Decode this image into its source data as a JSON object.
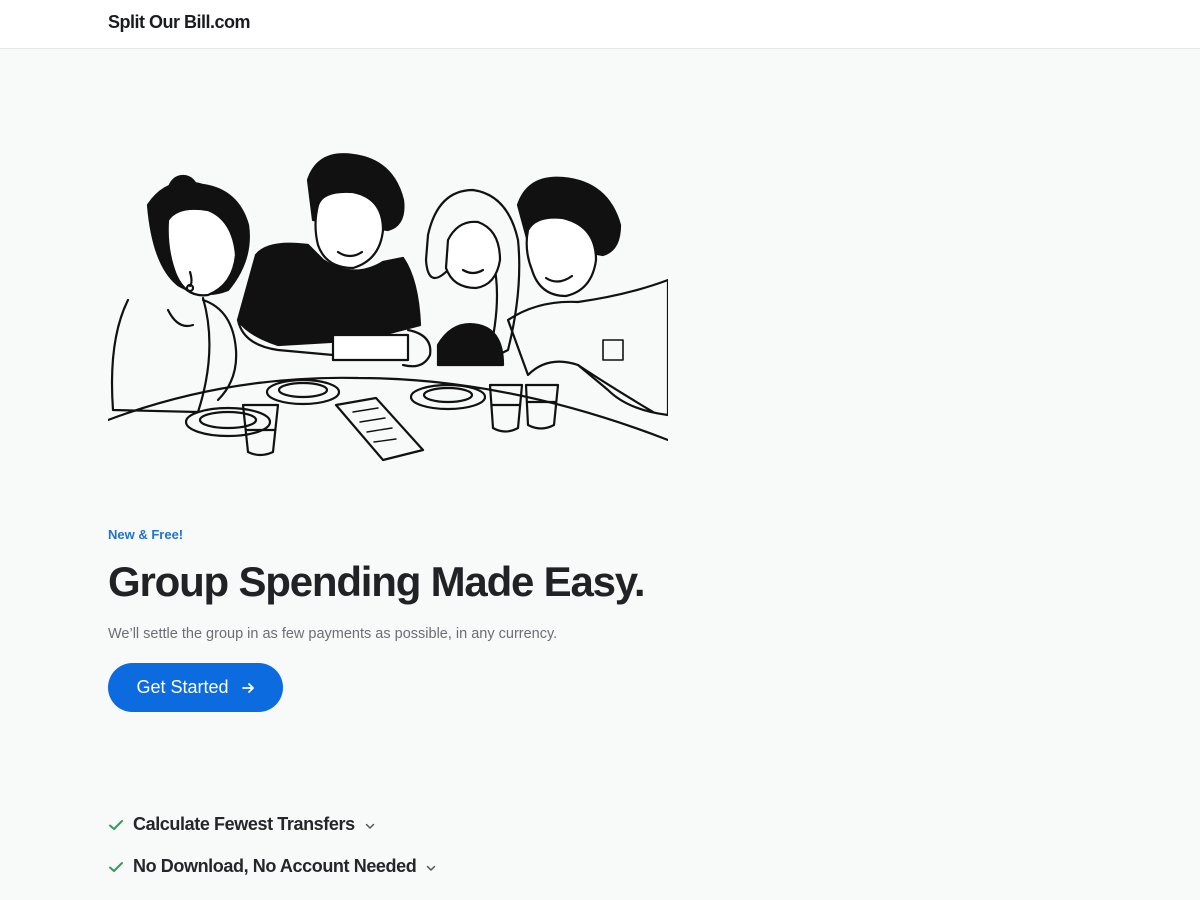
{
  "header": {
    "brand": "Split Our Bill.com"
  },
  "hero": {
    "illustration_icon": "friends-sharing-bill-illustration",
    "eyebrow": "New & Free!",
    "headline": "Group Spending Made Easy.",
    "subtext": "We’ll settle the group in as few payments as possible, in any currency.",
    "cta_label": "Get Started",
    "cta_icon": "arrow-right-icon"
  },
  "features": [
    {
      "label": "Calculate Fewest Transfers",
      "icon": "check-icon",
      "toggle_icon": "chevron-down-icon"
    },
    {
      "label": "No Download, No Account Needed",
      "icon": "check-icon",
      "toggle_icon": "chevron-down-icon"
    }
  ],
  "colors": {
    "accent": "#0b6bdf",
    "eyebrow": "#1f73d1",
    "check": "#2f9e5a",
    "background": "#f8f9f9"
  }
}
